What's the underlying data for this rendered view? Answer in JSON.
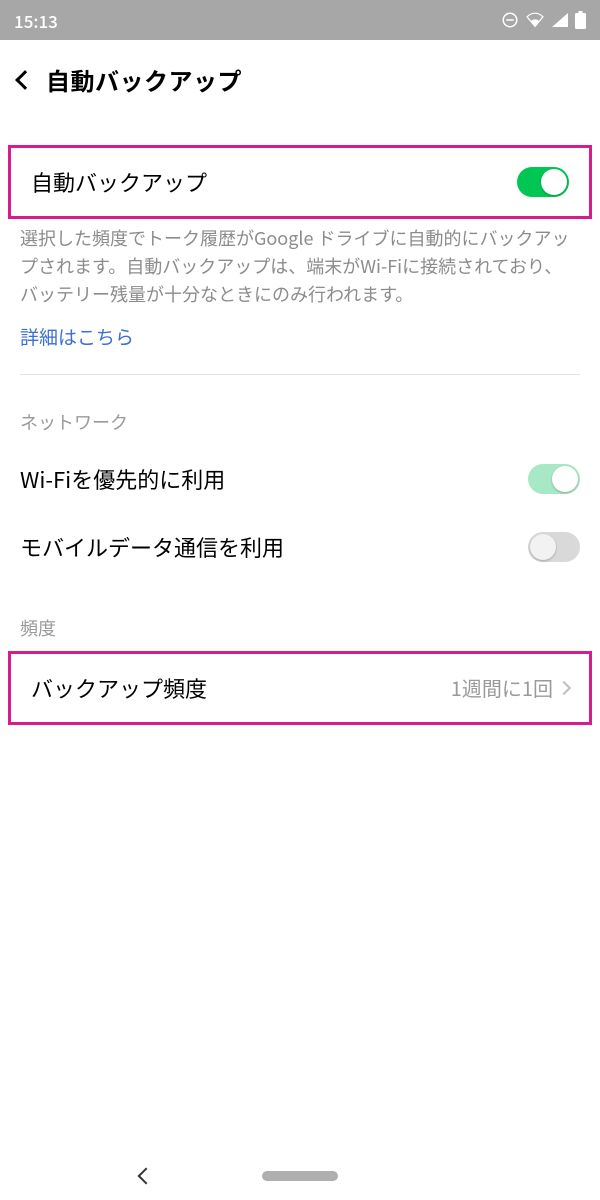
{
  "status": {
    "time": "15:13"
  },
  "appbar": {
    "title": "自動バックアップ"
  },
  "auto_backup": {
    "label": "自動バックアップ",
    "enabled": true,
    "description": "選択した頻度でトーク履歴がGoogle ドライブに自動的にバックアップされます。自動バックアップは、端末がWi-Fiに接続されており、バッテリー残量が十分なときにのみ行われます。",
    "link_label": "詳細はこちら"
  },
  "network": {
    "header": "ネットワーク",
    "wifi": {
      "label": "Wi-Fiを優先的に利用",
      "enabled": true
    },
    "mobile": {
      "label": "モバイルデータ通信を利用",
      "enabled": false
    }
  },
  "frequency": {
    "header": "頻度",
    "label": "バックアップ頻度",
    "value": "1週間に1回"
  }
}
